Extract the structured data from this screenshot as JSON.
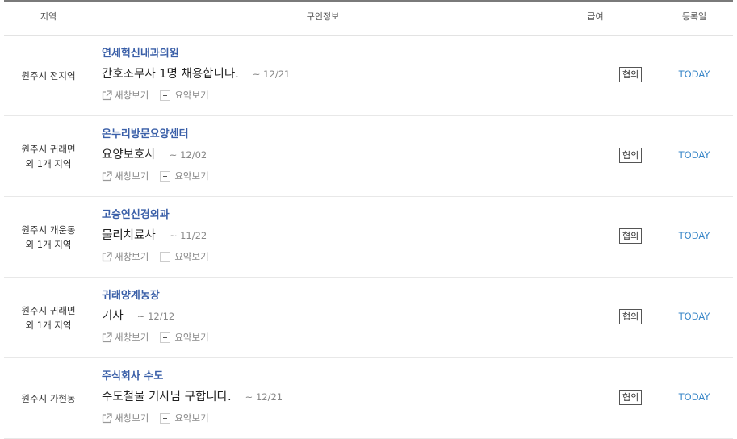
{
  "header": {
    "region": "지역",
    "info": "구인정보",
    "salary": "급여",
    "date": "등록일"
  },
  "actions": {
    "new_window": "새창보기",
    "summary": "요약보기"
  },
  "rows": [
    {
      "region_line1": "원주시 전지역",
      "region_line2": "",
      "company": "연세혁신내과의원",
      "title": "간호조무사 1명 채용합니다.",
      "deadline": "~ 12/21",
      "salary": "협의",
      "date": "TODAY"
    },
    {
      "region_line1": "원주시 귀래면",
      "region_line2": "외 1개 지역",
      "company": "온누리방문요양센터",
      "title": "요양보호사",
      "deadline": "~ 12/02",
      "salary": "협의",
      "date": "TODAY"
    },
    {
      "region_line1": "원주시 개운동",
      "region_line2": "외 1개 지역",
      "company": "고승연신경외과",
      "title": "물리치료사",
      "deadline": "~ 11/22",
      "salary": "협의",
      "date": "TODAY"
    },
    {
      "region_line1": "원주시 귀래면",
      "region_line2": "외 1개 지역",
      "company": "귀래양계농장",
      "title": "기사",
      "deadline": "~ 12/12",
      "salary": "협의",
      "date": "TODAY"
    },
    {
      "region_line1": "원주시 가현동",
      "region_line2": "",
      "company": "주식회사 수도",
      "title": "수도철물 기사님 구합니다.",
      "deadline": "~ 12/21",
      "salary": "협의",
      "date": "TODAY"
    }
  ]
}
